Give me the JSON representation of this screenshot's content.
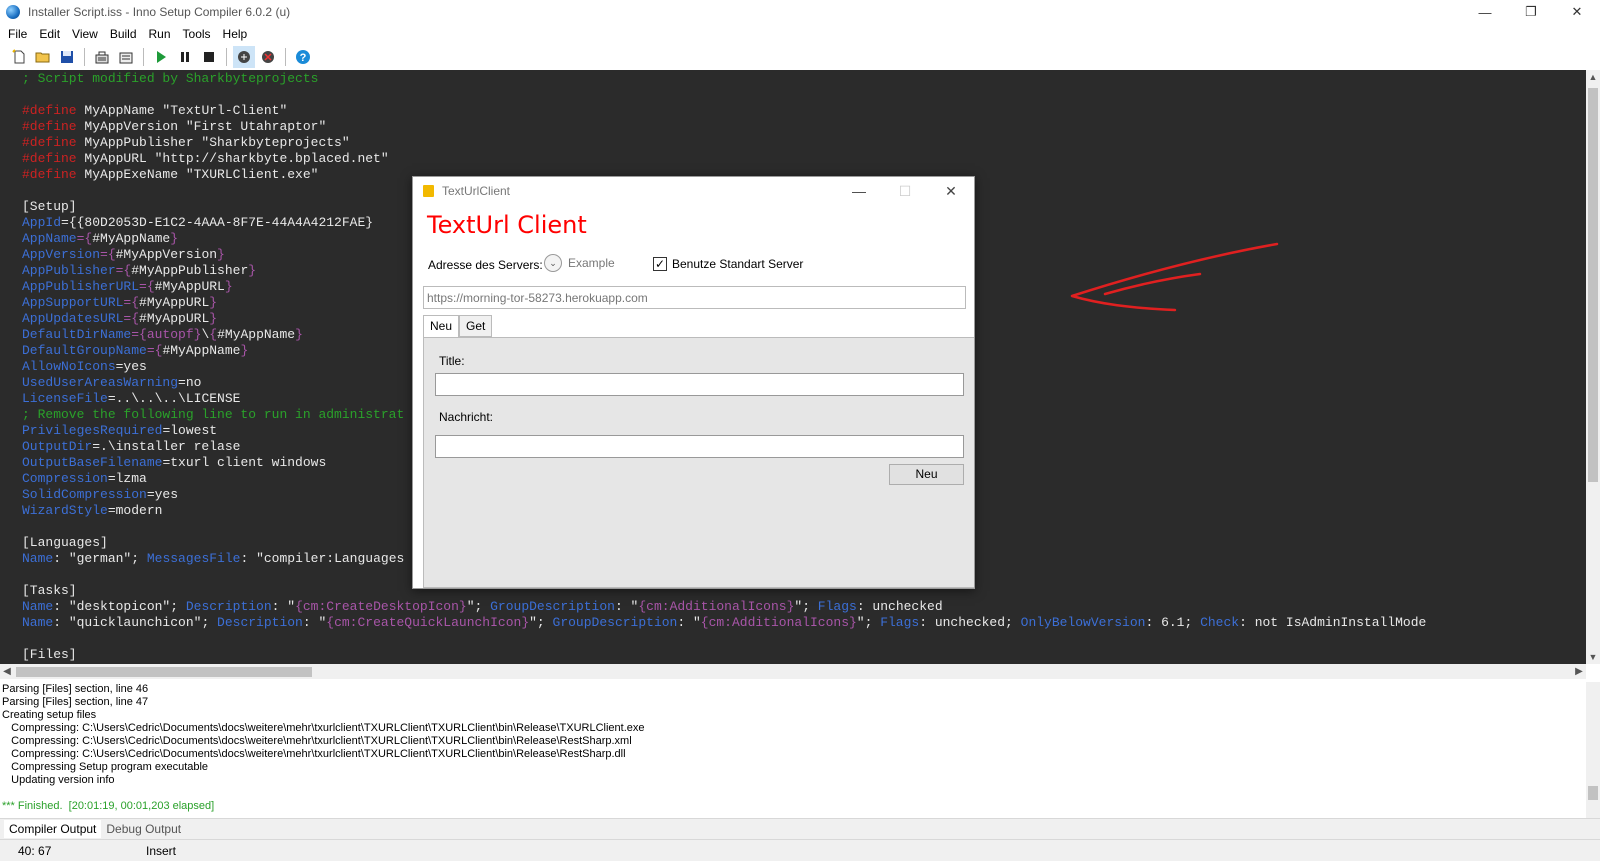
{
  "window": {
    "title": "Installer Script.iss - Inno Setup Compiler 6.0.2 (u)",
    "minimize_icon": "—",
    "restore_icon": "❐",
    "close_icon": "✕"
  },
  "menu": {
    "items": [
      {
        "label": "File"
      },
      {
        "label": "Edit"
      },
      {
        "label": "View"
      },
      {
        "label": "Build"
      },
      {
        "label": "Run"
      },
      {
        "label": "Tools"
      },
      {
        "label": "Help"
      }
    ]
  },
  "toolbar": {
    "icons": [
      "new-file-icon",
      "open-folder-icon",
      "save-icon",
      "compile-icon",
      "stop-compile-icon",
      "run-icon",
      "pause-icon",
      "stop-icon",
      "debug-icon",
      "debug-step-icon",
      "help-icon"
    ]
  },
  "editor": {
    "lines": [
      [
        {
          "t": "; Script modified by Sharkbyteprojects",
          "c": "c-comment"
        }
      ],
      [],
      [
        {
          "t": "#define",
          "c": "c-define"
        },
        {
          "t": " MyAppName \"",
          "c": "c-white"
        },
        {
          "t": "TextUrl-Client",
          "c": "c-str"
        },
        {
          "t": "\"",
          "c": "c-white"
        }
      ],
      [
        {
          "t": "#define",
          "c": "c-define"
        },
        {
          "t": " MyAppVersion \"First Utahraptor\"",
          "c": "c-white"
        }
      ],
      [
        {
          "t": "#define",
          "c": "c-define"
        },
        {
          "t": " MyAppPublisher \"Sharkbyteprojects\"",
          "c": "c-white"
        }
      ],
      [
        {
          "t": "#define",
          "c": "c-define"
        },
        {
          "t": " MyAppURL \"http://sharkbyte.bplaced.net\"",
          "c": "c-white"
        }
      ],
      [
        {
          "t": "#define",
          "c": "c-define"
        },
        {
          "t": " MyAppExeName \"TXURLClient.exe\"",
          "c": "c-white"
        }
      ],
      [],
      [
        {
          "t": "[Setup]",
          "c": "c-section"
        }
      ],
      [
        {
          "t": "AppId",
          "c": "c-key"
        },
        {
          "t": "={{80D2053D-E1C2-4AAA-8F7E-44A4A4212FAE}",
          "c": "c-white"
        }
      ],
      [
        {
          "t": "AppName",
          "c": "c-key"
        },
        {
          "t": "={",
          "c": "c-const"
        },
        {
          "t": "#MyAppName",
          "c": "c-white"
        },
        {
          "t": "}",
          "c": "c-const"
        }
      ],
      [
        {
          "t": "AppVersion",
          "c": "c-key"
        },
        {
          "t": "={",
          "c": "c-const"
        },
        {
          "t": "#MyAppVersion",
          "c": "c-white"
        },
        {
          "t": "}",
          "c": "c-const"
        }
      ],
      [
        {
          "t": "AppPublisher",
          "c": "c-key"
        },
        {
          "t": "={",
          "c": "c-const"
        },
        {
          "t": "#MyAppPublisher",
          "c": "c-white"
        },
        {
          "t": "}",
          "c": "c-const"
        }
      ],
      [
        {
          "t": "AppPublisherURL",
          "c": "c-key"
        },
        {
          "t": "={",
          "c": "c-const"
        },
        {
          "t": "#MyAppURL",
          "c": "c-white"
        },
        {
          "t": "}",
          "c": "c-const"
        }
      ],
      [
        {
          "t": "AppSupportURL",
          "c": "c-key"
        },
        {
          "t": "={",
          "c": "c-const"
        },
        {
          "t": "#MyAppURL",
          "c": "c-white"
        },
        {
          "t": "}",
          "c": "c-const"
        }
      ],
      [
        {
          "t": "AppUpdatesURL",
          "c": "c-key"
        },
        {
          "t": "={",
          "c": "c-const"
        },
        {
          "t": "#MyAppURL",
          "c": "c-white"
        },
        {
          "t": "}",
          "c": "c-const"
        }
      ],
      [
        {
          "t": "DefaultDirName",
          "c": "c-key"
        },
        {
          "t": "={autopf}",
          "c": "c-const"
        },
        {
          "t": "\\",
          "c": "c-white"
        },
        {
          "t": "{",
          "c": "c-const"
        },
        {
          "t": "#MyAppName",
          "c": "c-white"
        },
        {
          "t": "}",
          "c": "c-const"
        }
      ],
      [
        {
          "t": "DefaultGroupName",
          "c": "c-key"
        },
        {
          "t": "={",
          "c": "c-const"
        },
        {
          "t": "#MyAppName",
          "c": "c-white"
        },
        {
          "t": "}",
          "c": "c-const"
        }
      ],
      [
        {
          "t": "AllowNoIcons",
          "c": "c-key"
        },
        {
          "t": "=yes",
          "c": "c-white"
        }
      ],
      [
        {
          "t": "UsedUserAreasWarning",
          "c": "c-key"
        },
        {
          "t": "=no",
          "c": "c-white"
        }
      ],
      [
        {
          "t": "LicenseFile",
          "c": "c-key"
        },
        {
          "t": "=..\\..\\..\\LICENSE",
          "c": "c-white"
        }
      ],
      [
        {
          "t": "; Remove the following line to run in administrat",
          "c": "c-comment"
        }
      ],
      [
        {
          "t": "PrivilegesRequired",
          "c": "c-key"
        },
        {
          "t": "=lowest",
          "c": "c-white"
        }
      ],
      [
        {
          "t": "OutputDir",
          "c": "c-key"
        },
        {
          "t": "=.\\installer relase",
          "c": "c-white"
        }
      ],
      [
        {
          "t": "OutputBaseFilename",
          "c": "c-key"
        },
        {
          "t": "=txurl client windows",
          "c": "c-white"
        }
      ],
      [
        {
          "t": "Compression",
          "c": "c-key"
        },
        {
          "t": "=lzma",
          "c": "c-white"
        }
      ],
      [
        {
          "t": "SolidCompression",
          "c": "c-key"
        },
        {
          "t": "=yes",
          "c": "c-white"
        }
      ],
      [
        {
          "t": "WizardStyle",
          "c": "c-key"
        },
        {
          "t": "=modern",
          "c": "c-white"
        }
      ],
      [],
      [
        {
          "t": "[Languages]",
          "c": "c-section"
        }
      ],
      [
        {
          "t": "Name",
          "c": "c-key"
        },
        {
          "t": ": \"german\"; ",
          "c": "c-white"
        },
        {
          "t": "MessagesFile",
          "c": "c-key"
        },
        {
          "t": ": \"compiler:Languages",
          "c": "c-white"
        }
      ],
      [],
      [
        {
          "t": "[Tasks]",
          "c": "c-section"
        }
      ],
      [
        {
          "t": "Name",
          "c": "c-key"
        },
        {
          "t": ": \"desktopicon\"; ",
          "c": "c-white"
        },
        {
          "t": "Description",
          "c": "c-key"
        },
        {
          "t": ": \"",
          "c": "c-white"
        },
        {
          "t": "{cm:CreateDesktopIcon}",
          "c": "c-const"
        },
        {
          "t": "\"; ",
          "c": "c-white"
        },
        {
          "t": "GroupDescription",
          "c": "c-key"
        },
        {
          "t": ": \"",
          "c": "c-white"
        },
        {
          "t": "{cm:AdditionalIcons}",
          "c": "c-const"
        },
        {
          "t": "\"; ",
          "c": "c-white"
        },
        {
          "t": "Flags",
          "c": "c-key"
        },
        {
          "t": ": unchecked",
          "c": "c-white"
        }
      ],
      [
        {
          "t": "Name",
          "c": "c-key"
        },
        {
          "t": ": \"quicklaunchicon\"; ",
          "c": "c-white"
        },
        {
          "t": "Description",
          "c": "c-key"
        },
        {
          "t": ": \"",
          "c": "c-white"
        },
        {
          "t": "{cm:CreateQuickLaunchIcon}",
          "c": "c-const"
        },
        {
          "t": "\"; ",
          "c": "c-white"
        },
        {
          "t": "GroupDescription",
          "c": "c-key"
        },
        {
          "t": ": \"",
          "c": "c-white"
        },
        {
          "t": "{cm:AdditionalIcons}",
          "c": "c-const"
        },
        {
          "t": "\"; ",
          "c": "c-white"
        },
        {
          "t": "Flags",
          "c": "c-key"
        },
        {
          "t": ": unchecked; ",
          "c": "c-white"
        },
        {
          "t": "OnlyBelowVersion",
          "c": "c-key"
        },
        {
          "t": ": 6.1; ",
          "c": "c-white"
        },
        {
          "t": "Check",
          "c": "c-key"
        },
        {
          "t": ": not IsAdminInstallMode",
          "c": "c-white"
        }
      ],
      [],
      [
        {
          "t": "[Files]",
          "c": "c-section"
        }
      ]
    ]
  },
  "output": {
    "lines": [
      "Parsing [Files] section, line 46",
      "Parsing [Files] section, line 47",
      "Creating setup files",
      "   Compressing: C:\\Users\\Cedric\\Documents\\docs\\weitere\\mehr\\txurlclient\\TXURLClient\\TXURLClient\\bin\\Release\\TXURLClient.exe",
      "   Compressing: C:\\Users\\Cedric\\Documents\\docs\\weitere\\mehr\\txurlclient\\TXURLClient\\TXURLClient\\bin\\Release\\RestSharp.xml",
      "   Compressing: C:\\Users\\Cedric\\Documents\\docs\\weitere\\mehr\\txurlclient\\TXURLClient\\TXURLClient\\bin\\Release\\RestSharp.dll",
      "   Compressing Setup program executable",
      "   Updating version info"
    ],
    "finished": "*** Finished.  [20:01:19, 00:01,203 elapsed]"
  },
  "output_tabs": {
    "compiler": "Compiler Output",
    "debug": "Debug Output"
  },
  "status": {
    "position": "40:  67",
    "mode": "Insert"
  },
  "dialog": {
    "title": "TextUrlClient",
    "heading": "TextUrl Client",
    "server_label": "Adresse des Servers:",
    "example_label": "Example",
    "standard_label": "Benutze Standart Server",
    "standard_checked": true,
    "url_value": "https://morning-tor-58273.herokuapp.com",
    "tabs": [
      {
        "label": "Neu"
      },
      {
        "label": "Get"
      }
    ],
    "title_label": "Title:",
    "message_label": "Nachricht:",
    "submit_label": "Neu"
  },
  "colors": {
    "editor_bg": "#2b2b2b",
    "heading_red": "#ff0000",
    "comment_green": "#2aa12a",
    "keyword_blue": "#3c6fd6",
    "annotation_red": "#e02020"
  }
}
